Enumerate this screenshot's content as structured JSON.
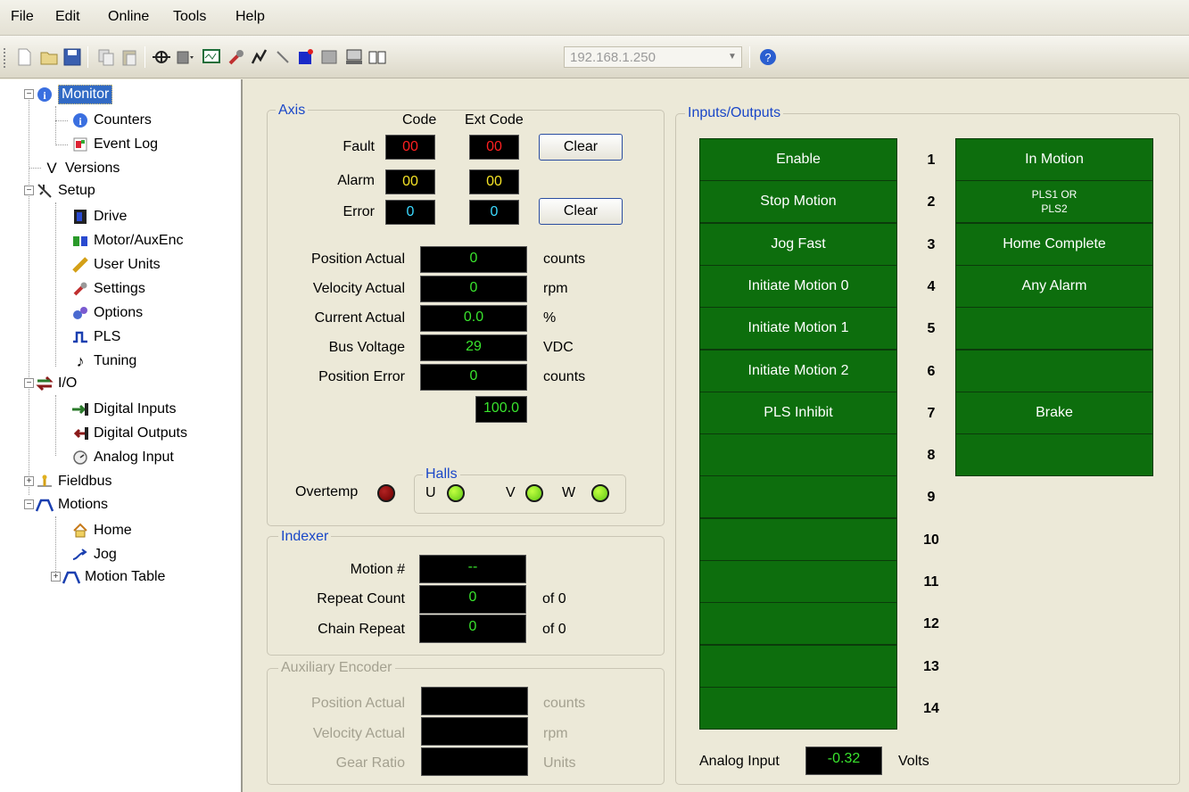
{
  "menu": {
    "file": "File",
    "edit": "Edit",
    "online": "Online",
    "tools": "Tools",
    "help": "Help"
  },
  "toolbar": {
    "ip_value": "192.168.1.250"
  },
  "tree": {
    "monitor": "Monitor",
    "counters": "Counters",
    "event_log": "Event Log",
    "versions": "Versions",
    "setup": "Setup",
    "drive": "Drive",
    "motor_auxenc": "Motor/AuxEnc",
    "user_units": "User Units",
    "settings": "Settings",
    "options": "Options",
    "pls": "PLS",
    "tuning": "Tuning",
    "io": "I/O",
    "digital_inputs": "Digital Inputs",
    "digital_outputs": "Digital Outputs",
    "analog_input": "Analog Input",
    "fieldbus": "Fieldbus",
    "motions": "Motions",
    "home": "Home",
    "jog": "Jog",
    "motion_table": "Motion Table"
  },
  "axis": {
    "title": "Axis",
    "code_header": "Code",
    "ext_code_header": "Ext Code",
    "fault_label": "Fault",
    "fault_code": "00",
    "fault_ext": "00",
    "alarm_label": "Alarm",
    "alarm_code": "00",
    "alarm_ext": "00",
    "error_label": "Error",
    "error_code": "0",
    "error_ext": "0",
    "clear_fault": "Clear",
    "clear_error": "Clear",
    "position_actual_label": "Position Actual",
    "position_actual_value": "0",
    "position_actual_unit": "counts",
    "velocity_actual_label": "Velocity Actual",
    "velocity_actual_value": "0",
    "velocity_actual_unit": "rpm",
    "current_actual_label": "Current Actual",
    "current_actual_value": "0.0",
    "current_actual_unit": "%",
    "bus_voltage_label": "Bus Voltage",
    "bus_voltage_value": "29",
    "bus_voltage_unit": "VDC",
    "position_error_label": "Position Error",
    "position_error_value": "0",
    "position_error_unit": "counts",
    "extra_value": "100.0",
    "overtemp_label": "Overtemp",
    "halls_title": "Halls",
    "hall_u": "U",
    "hall_v": "V",
    "hall_w": "W"
  },
  "indexer": {
    "title": "Indexer",
    "motion_label": "Motion #",
    "motion_value": "--",
    "repeat_count_label": "Repeat Count",
    "repeat_count_value": "0",
    "repeat_count_of": "of 0",
    "chain_repeat_label": "Chain Repeat",
    "chain_repeat_value": "0",
    "chain_repeat_of": "of 0"
  },
  "aux_encoder": {
    "title": "Auxiliary Encoder",
    "position_label": "Position Actual",
    "position_unit": "counts",
    "velocity_label": "Velocity Actual",
    "velocity_unit": "rpm",
    "gear_label": "Gear Ratio",
    "gear_unit": "Units"
  },
  "io": {
    "title": "Inputs/Outputs",
    "inputs": [
      "Enable",
      "Stop Motion",
      "Jog Fast",
      "Initiate Motion 0",
      "Initiate Motion 1",
      "Initiate Motion 2",
      "PLS Inhibit",
      "",
      "",
      "",
      "",
      "",
      "",
      ""
    ],
    "numbers": [
      "1",
      "2",
      "3",
      "4",
      "5",
      "6",
      "7",
      "8",
      "9",
      "10",
      "11",
      "12",
      "13",
      "14"
    ],
    "outputs": [
      "In Motion",
      "PLS1 OR\nPLS2",
      "Home Complete",
      "Any Alarm",
      "",
      "",
      "Brake",
      ""
    ],
    "analog_label": "Analog Input",
    "analog_value": "-0.32",
    "analog_unit": "Volts"
  },
  "colors": {
    "io_on": "#0d6e0d",
    "selection": "#316ac5",
    "group_title": "#1a47c8"
  }
}
